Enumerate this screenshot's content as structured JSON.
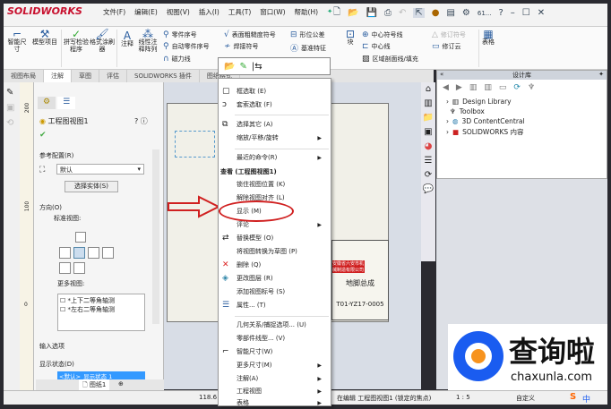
{
  "app": {
    "brand": "SOLIDWORKS",
    "menu": [
      "文件(F)",
      "编辑(E)",
      "视图(V)",
      "插入(I)",
      "工具(T)",
      "窗口(W)",
      "帮助(H)"
    ],
    "search_hint": "61..."
  },
  "ribbon": {
    "smart_dim": "智能尺寸",
    "model_items": "模型项目",
    "spell": "拼写检验程序",
    "format_painter": "格式涂刷器",
    "note": "注释",
    "linear_note": "线性注释阵列",
    "balloon": "零件序号",
    "auto_balloon": "自动零件序号",
    "magnetic": "磁力线",
    "surface": "表面粗糙度符号",
    "weld": "焊接符号",
    "gtol": "形位公差",
    "datum": "基准特征",
    "block": "块",
    "center_mark": "中心符号线",
    "centerline": "中心线",
    "hatch": "区域剖面线/填充",
    "rev_symbol": "修订符号",
    "rev_cloud": "修订云",
    "tables": "表格"
  },
  "tabs": [
    "视图布局",
    "注解",
    "草图",
    "评估",
    "SOLIDWORKS 插件",
    "图纸格式"
  ],
  "pm": {
    "title": "工程图视图1",
    "ref_config": "参考配置(R)",
    "config_value": "默认",
    "select_bodies": "选择实体(S)",
    "orientation": "方向(O)",
    "standard_views": "标准视图:",
    "more_views": "更多视图:",
    "more_view_items": [
      "*上下二等角轴测",
      "*左右二等角轴测"
    ],
    "import_options": "输入选项",
    "display_state": "显示状态(D)",
    "display_state_value": "<默认>_显示状态 1",
    "ruler_marks": [
      "200",
      "100",
      "0"
    ]
  },
  "sheet": {
    "tab": "图纸1",
    "title": "地脚总成",
    "number": "T01-YZ17-0005",
    "company": "安徽省六安市机械制造有限公司"
  },
  "context_menu": {
    "top": [
      {
        "label": "框选取 (E)",
        "icon": "▢"
      },
      {
        "label": "套索选取 (F)",
        "icon": "ↄ"
      },
      {
        "label": "选择其它 (A)",
        "icon": "⧉"
      },
      {
        "label": "缩放/平移/旋转",
        "sub": true
      },
      {
        "label": "最近的命令(R)",
        "sub": true
      }
    ],
    "section": "查看 (工程图视图1)",
    "items": [
      {
        "label": "锁住视图位置 (K)"
      },
      {
        "label": "解除视图对齐 (L)"
      },
      {
        "label": "显示 (M)"
      },
      {
        "label": "评论",
        "sub": true
      },
      {
        "label": "替换模型 (O)",
        "icon": "⇄"
      },
      {
        "label": "将视图转换为草图 (P)"
      },
      {
        "label": "删除 (Q)",
        "icon": "✕"
      },
      {
        "label": "更改图层 (R)",
        "icon": "◈"
      },
      {
        "label": "添加视图标号 (S)"
      },
      {
        "label": "属性... (T)",
        "icon": "☰"
      }
    ],
    "bottom": [
      {
        "label": "几何关系/捕捉选项... (U)"
      },
      {
        "label": "零部件线型... (V)"
      },
      {
        "label": "智能尺寸(W)",
        "icon": "⌐"
      },
      {
        "label": "更多尺寸(M)",
        "sub": true
      },
      {
        "label": "注解(A)",
        "sub": true
      },
      {
        "label": "工程视图",
        "sub": true
      },
      {
        "label": "表格",
        "sub": true
      }
    ]
  },
  "library": {
    "title": "设计库",
    "items": [
      "Design Library",
      "Toolbox",
      "3D ContentCentral",
      "SOLIDWORKS 内容"
    ]
  },
  "status": {
    "coord": "118.6",
    "editing": "在编辑 工程图视图1 (锁定的焦点)",
    "scale": "1 : 5",
    "units": "自定义",
    "ime": "中"
  },
  "watermark": {
    "name": "查询啦",
    "url": "chaxunla.com"
  },
  "colors": {
    "brand": "#c8102e",
    "highlight": "#3399ff",
    "annotation": "#d02020"
  }
}
